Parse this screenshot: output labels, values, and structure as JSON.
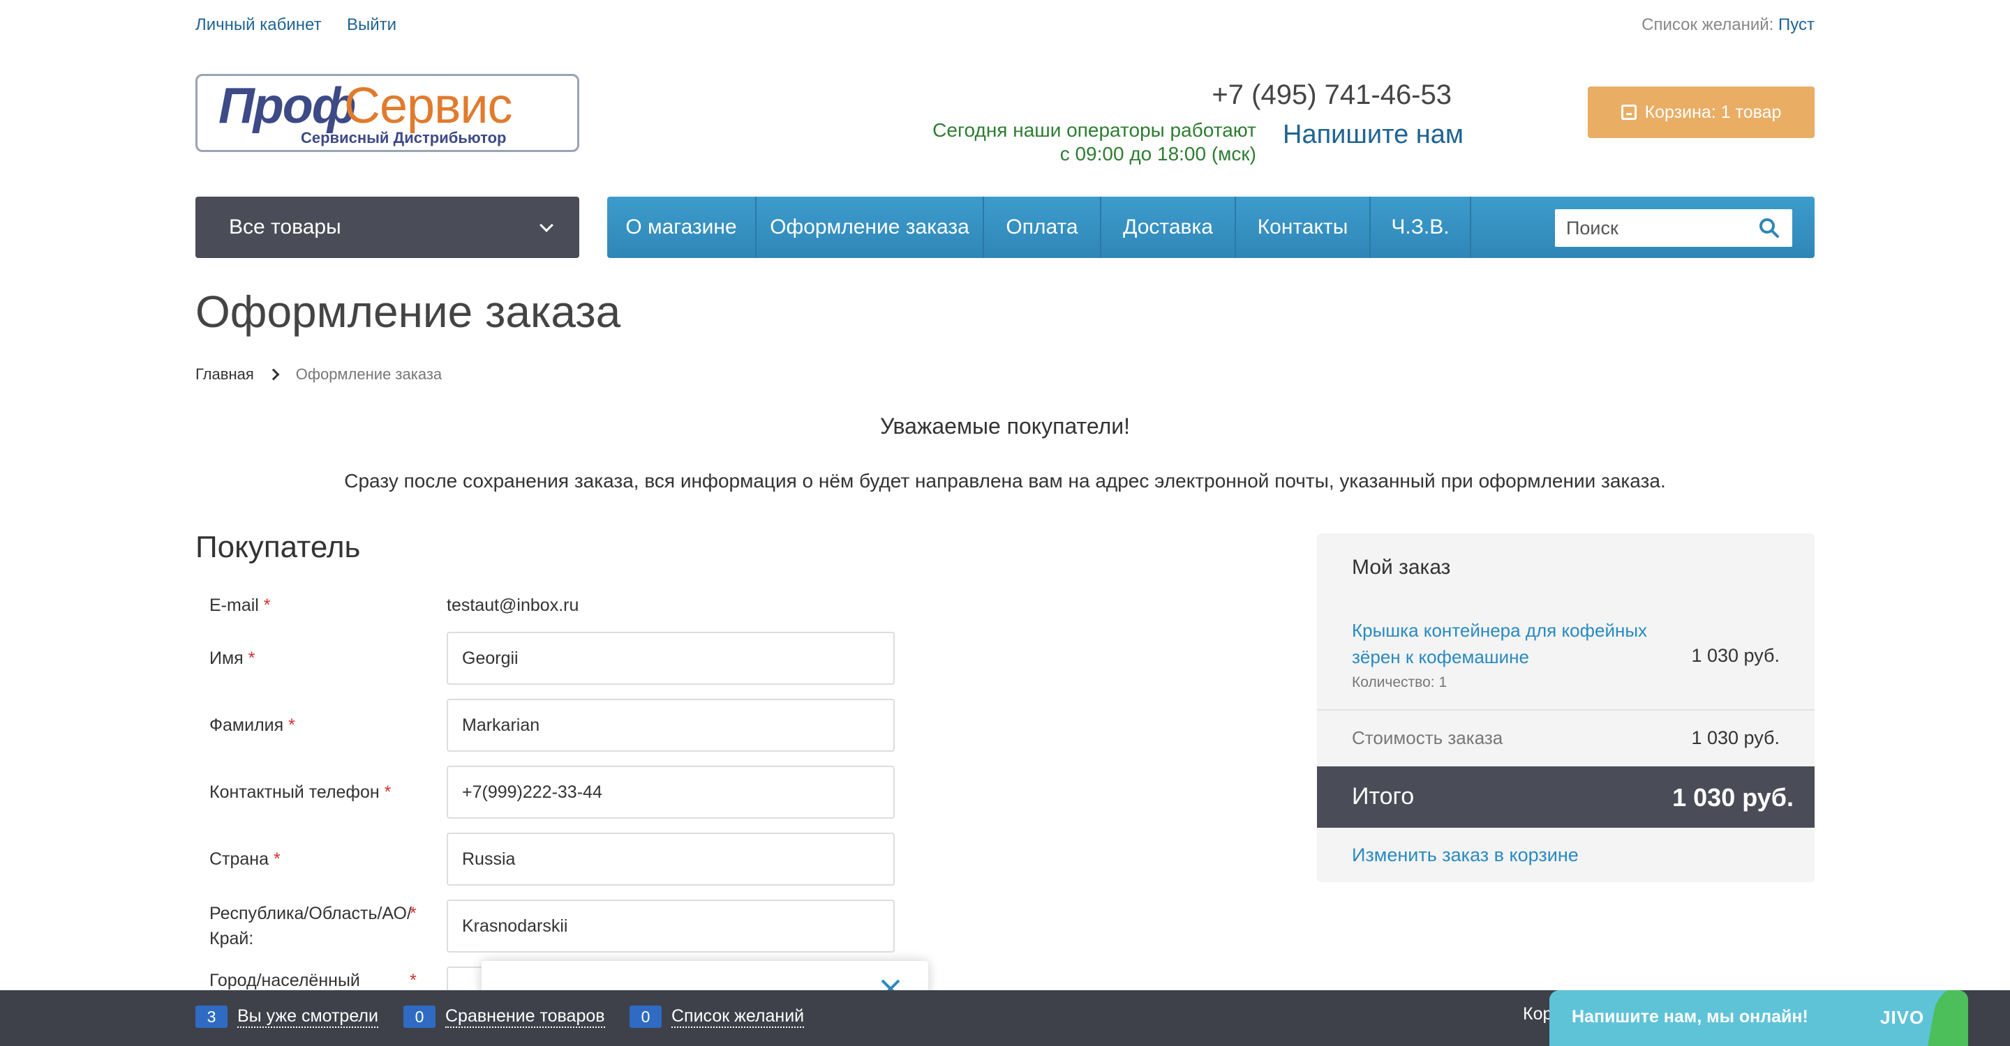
{
  "top": {
    "account_link": "Личный кабинет",
    "logout_link": "Выйти",
    "wishlist_label": "Список желаний:",
    "wishlist_value": "Пуст"
  },
  "logo": {
    "part1": "Проф",
    "part2": "Сервис",
    "subtitle": "Сервисный Дистрибьютор"
  },
  "header": {
    "phone": "+7 (495) 741-46-53",
    "hours_line1": "Сегодня наши операторы работают",
    "hours_line2": "с 09:00 до 18:00 (мск)",
    "write_us": "Напишите нам",
    "cart": "Корзина: 1 товар"
  },
  "nav": {
    "all_goods": "Все товары",
    "menu": [
      "О магазине",
      "Оформление заказа",
      "Оплата",
      "Доставка",
      "Контакты",
      "Ч.З.В."
    ],
    "search_placeholder": "Поиск"
  },
  "page": {
    "title": "Оформление заказа",
    "breadcrumb_home": "Главная",
    "breadcrumb_current": "Оформление заказа",
    "greeting": "Уважаемые покупатели!",
    "notice": "Сразу после сохранения заказа, вся информация о нём будет направлена вам на адрес электронной почты, указанный при оформлении заказа."
  },
  "buyer": {
    "title": "Покупатель",
    "fields": [
      {
        "label": "E-mail",
        "value": "testaut@inbox.ru"
      },
      {
        "label": "Имя",
        "value": "Georgii"
      },
      {
        "label": "Фамилия",
        "value": "Markarian"
      },
      {
        "label": "Контактный телефон",
        "value": "+7(999)222-33-44"
      },
      {
        "label": "Страна",
        "value": "Russia"
      },
      {
        "label": "Республика/Область/АО/ Край:",
        "value": "Krasnodarskii"
      },
      {
        "label": "Город/населённый",
        "value": ""
      }
    ],
    "required_mark": "*"
  },
  "order": {
    "title": "Мой заказ",
    "item_name": "Крышка контейнера для кофейных зёрен к кофемашине",
    "item_qty": "Количество: 1",
    "item_price": "1 030 руб.",
    "cost_label": "Стоимость заказа",
    "cost_value": "1 030 руб.",
    "total_label": "Итого",
    "total_value": "1 030 руб.",
    "change_link": "Изменить заказ в корзине"
  },
  "bottom_bar": {
    "viewed_count": "3",
    "viewed_label": "Вы уже смотрели",
    "compare_count": "0",
    "compare_label": "Сравнение товаров",
    "wishlist_count": "0",
    "wishlist_label": "Список желаний",
    "right_label": "Кор"
  },
  "jivo": {
    "text": "Напишите нам, мы онлайн!",
    "brand": "JIVO"
  },
  "colors": {
    "menu_blue": "#3d9ccd",
    "dark": "#4a4d57",
    "cart_orange": "#e9ad64",
    "link_blue": "#2a8ac0",
    "hours_green": "#2e7d32",
    "jivo": "#5fc3d8"
  }
}
